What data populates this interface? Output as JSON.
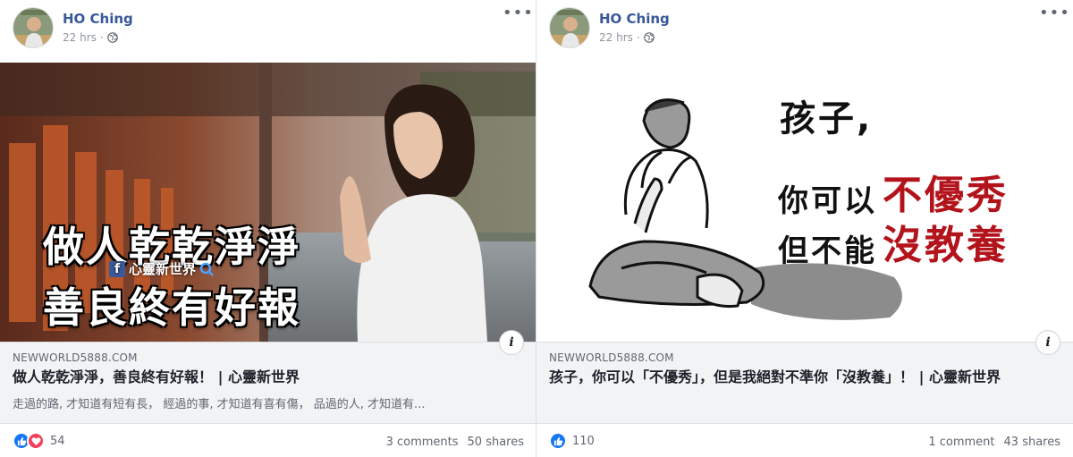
{
  "posts": [
    {
      "author": "HO Ching",
      "time": "22 hrs",
      "image_overlay": {
        "line1": "做人乾乾淨淨",
        "line2": "善良終有好報",
        "brand": "心靈新世界"
      },
      "link": {
        "domain": "NEWWORLD5888.COM",
        "title": "做人乾乾淨淨，善良終有好報！ | 心靈新世界",
        "description": "走過的路, 才知道有短有長， 經過的事, 才知道有喜有傷， 品過的人, 才知道有..."
      },
      "reaction_count": "54",
      "comments": "3 comments",
      "shares": "50 shares",
      "reactions": [
        "like-icon",
        "love-icon"
      ]
    },
    {
      "author": "HO Ching",
      "time": "22 hrs",
      "image_overlay": {
        "line1": "孩子,",
        "line2a": "你可以",
        "line2b": "不優秀",
        "line3a": "但不能",
        "line3b": "沒教養"
      },
      "link": {
        "domain": "NEWWORLD5888.COM",
        "title": "孩子，你可以「不優秀」，但是我絕對不準你「沒教養」！ | 心靈新世界",
        "description": ""
      },
      "reaction_count": "110",
      "comments": "1 comment",
      "shares": "43 shares",
      "reactions": [
        "like-icon"
      ]
    }
  ],
  "colors": {
    "author_blue": "#385898",
    "like_blue": "#1877f2",
    "love_red": "#f33e58",
    "emphasis_red": "#b3141c"
  }
}
